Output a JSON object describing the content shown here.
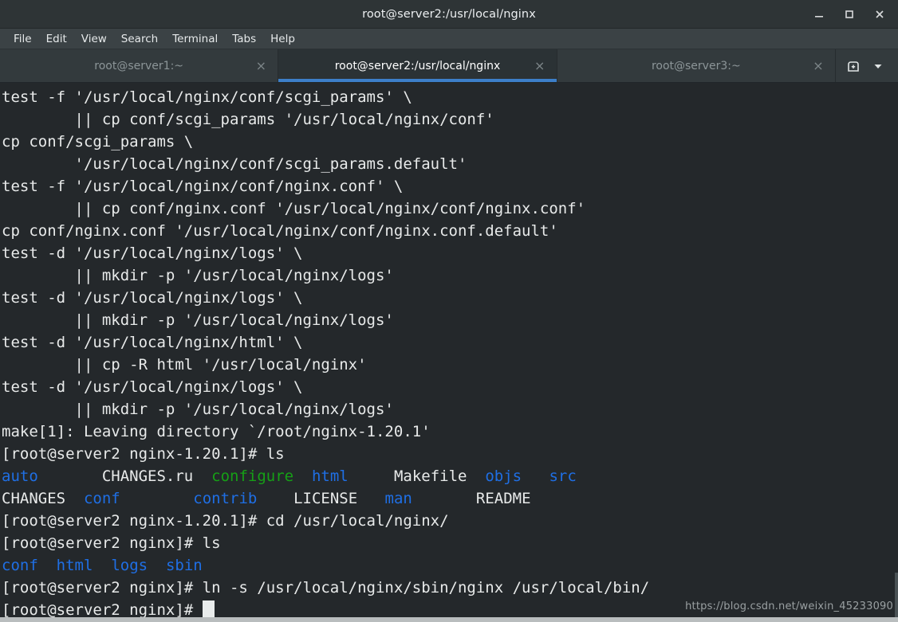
{
  "window": {
    "title": "root@server2:/usr/local/nginx",
    "controls": [
      {
        "name": "minimize",
        "glyph": "minimize-icon"
      },
      {
        "name": "maximize",
        "glyph": "maximize-icon"
      },
      {
        "name": "close",
        "glyph": "close-icon"
      }
    ]
  },
  "menubar": {
    "items": [
      "File",
      "Edit",
      "View",
      "Search",
      "Terminal",
      "Tabs",
      "Help"
    ]
  },
  "tabbar": {
    "tabs": [
      {
        "label": "root@server1:~",
        "active": false,
        "close": "×"
      },
      {
        "label": "root@server2:/usr/local/nginx",
        "active": true,
        "close": "×"
      },
      {
        "label": "root@server3:~",
        "active": false,
        "close": "×"
      }
    ],
    "new_tab_icon": "new-terminal-icon",
    "tab_list_icon": "chevron-down-icon"
  },
  "colors": {
    "terminal_bg": "#24282b",
    "foreground": "#e8eaea",
    "directory_blue": "#1f6fe5",
    "executable_green": "#16a016",
    "accent_blue": "#3d7fc9",
    "titlebar_bg": "#2e3436",
    "menubar_bg": "#3b4245",
    "tabbar_bg": "#333a3d"
  },
  "terminal": {
    "prompt_host": "[root@server2 nginx-1.20.1]#",
    "prompt_host_short": "[root@server2 nginx]#",
    "cursor": "block",
    "lines": [
      {
        "segments": [
          {
            "text": "test -f '/usr/local/nginx/conf/scgi_params' \\",
            "color": "white"
          }
        ]
      },
      {
        "segments": [
          {
            "text": "        || cp conf/scgi_params '/usr/local/nginx/conf'",
            "color": "white"
          }
        ]
      },
      {
        "segments": [
          {
            "text": "cp conf/scgi_params \\",
            "color": "white"
          }
        ]
      },
      {
        "segments": [
          {
            "text": "        '/usr/local/nginx/conf/scgi_params.default'",
            "color": "white"
          }
        ]
      },
      {
        "segments": [
          {
            "text": "test -f '/usr/local/nginx/conf/nginx.conf' \\",
            "color": "white"
          }
        ]
      },
      {
        "segments": [
          {
            "text": "        || cp conf/nginx.conf '/usr/local/nginx/conf/nginx.conf'",
            "color": "white"
          }
        ]
      },
      {
        "segments": [
          {
            "text": "cp conf/nginx.conf '/usr/local/nginx/conf/nginx.conf.default'",
            "color": "white"
          }
        ]
      },
      {
        "segments": [
          {
            "text": "test -d '/usr/local/nginx/logs' \\",
            "color": "white"
          }
        ]
      },
      {
        "segments": [
          {
            "text": "        || mkdir -p '/usr/local/nginx/logs'",
            "color": "white"
          }
        ]
      },
      {
        "segments": [
          {
            "text": "test -d '/usr/local/nginx/logs' \\",
            "color": "white"
          }
        ]
      },
      {
        "segments": [
          {
            "text": "        || mkdir -p '/usr/local/nginx/logs'",
            "color": "white"
          }
        ]
      },
      {
        "segments": [
          {
            "text": "test -d '/usr/local/nginx/html' \\",
            "color": "white"
          }
        ]
      },
      {
        "segments": [
          {
            "text": "        || cp -R html '/usr/local/nginx'",
            "color": "white"
          }
        ]
      },
      {
        "segments": [
          {
            "text": "test -d '/usr/local/nginx/logs' \\",
            "color": "white"
          }
        ]
      },
      {
        "segments": [
          {
            "text": "        || mkdir -p '/usr/local/nginx/logs'",
            "color": "white"
          }
        ]
      },
      {
        "segments": [
          {
            "text": "make[1]: Leaving directory `/root/nginx-1.20.1'",
            "color": "white"
          }
        ]
      },
      {
        "segments": [
          {
            "text": "[root@server2 nginx-1.20.1]# ls",
            "color": "white"
          }
        ]
      },
      {
        "segments": [
          {
            "text": "auto",
            "color": "blue"
          },
          {
            "text": "       ",
            "color": "white"
          },
          {
            "text": "CHANGES.ru",
            "color": "white"
          },
          {
            "text": "  ",
            "color": "white"
          },
          {
            "text": "configure",
            "color": "green"
          },
          {
            "text": "  ",
            "color": "white"
          },
          {
            "text": "html",
            "color": "blue"
          },
          {
            "text": "     ",
            "color": "white"
          },
          {
            "text": "Makefile",
            "color": "white"
          },
          {
            "text": "  ",
            "color": "white"
          },
          {
            "text": "objs",
            "color": "blue"
          },
          {
            "text": "   ",
            "color": "white"
          },
          {
            "text": "src",
            "color": "blue"
          }
        ]
      },
      {
        "segments": [
          {
            "text": "CHANGES",
            "color": "white"
          },
          {
            "text": "  ",
            "color": "white"
          },
          {
            "text": "conf",
            "color": "blue"
          },
          {
            "text": "        ",
            "color": "white"
          },
          {
            "text": "contrib",
            "color": "blue"
          },
          {
            "text": "    ",
            "color": "white"
          },
          {
            "text": "LICENSE",
            "color": "white"
          },
          {
            "text": "   ",
            "color": "white"
          },
          {
            "text": "man",
            "color": "blue"
          },
          {
            "text": "       ",
            "color": "white"
          },
          {
            "text": "README",
            "color": "white"
          }
        ]
      },
      {
        "segments": [
          {
            "text": "[root@server2 nginx-1.20.1]# cd /usr/local/nginx/",
            "color": "white"
          }
        ]
      },
      {
        "segments": [
          {
            "text": "[root@server2 nginx]# ls",
            "color": "white"
          }
        ]
      },
      {
        "segments": [
          {
            "text": "conf",
            "color": "blue"
          },
          {
            "text": "  ",
            "color": "white"
          },
          {
            "text": "html",
            "color": "blue"
          },
          {
            "text": "  ",
            "color": "white"
          },
          {
            "text": "logs",
            "color": "blue"
          },
          {
            "text": "  ",
            "color": "white"
          },
          {
            "text": "sbin",
            "color": "blue"
          }
        ]
      },
      {
        "segments": [
          {
            "text": "[root@server2 nginx]# ln -s /usr/local/nginx/sbin/nginx /usr/local/bin/",
            "color": "white"
          }
        ]
      },
      {
        "segments": [
          {
            "text": "[root@server2 nginx]# ",
            "color": "white"
          }
        ],
        "cursor": true
      }
    ]
  },
  "watermark": "https://blog.csdn.net/weixin_45233090"
}
